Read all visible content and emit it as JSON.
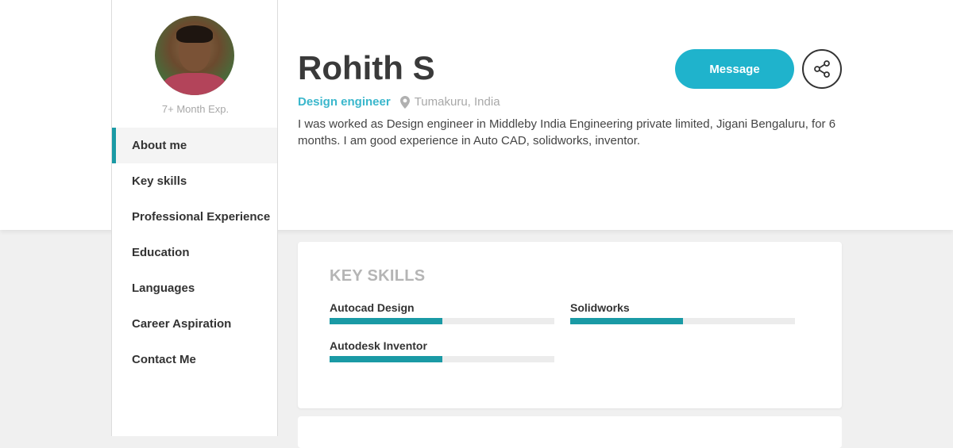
{
  "profile": {
    "name": "Rohith S",
    "experience": "7+ Month Exp.",
    "role": "Design engineer",
    "location": "Tumakuru, India",
    "bio": "I was worked as Design engineer in Middleby India Engineering private limited, Jigani Bengaluru, for 6 months. I am good experience in Auto CAD, solidworks, inventor."
  },
  "actions": {
    "message_label": "Message",
    "share_icon": "share-icon"
  },
  "nav": {
    "items": [
      {
        "label": "About me",
        "active": true
      },
      {
        "label": "Key skills",
        "active": false
      },
      {
        "label": "Professional Experience",
        "active": false
      },
      {
        "label": "Education",
        "active": false
      },
      {
        "label": "Languages",
        "active": false
      },
      {
        "label": "Career Aspiration",
        "active": false
      },
      {
        "label": "Contact Me",
        "active": false
      }
    ]
  },
  "key_skills": {
    "title": "KEY SKILLS",
    "skills": [
      {
        "name": "Autocad Design",
        "level": 0.5
      },
      {
        "name": "Solidworks",
        "level": 0.5
      },
      {
        "name": "Autodesk Inventor",
        "level": 0.5
      }
    ]
  },
  "colors": {
    "accent": "#1a9aa5",
    "button": "#1fb3cc",
    "role_text": "#3ab7cc"
  }
}
